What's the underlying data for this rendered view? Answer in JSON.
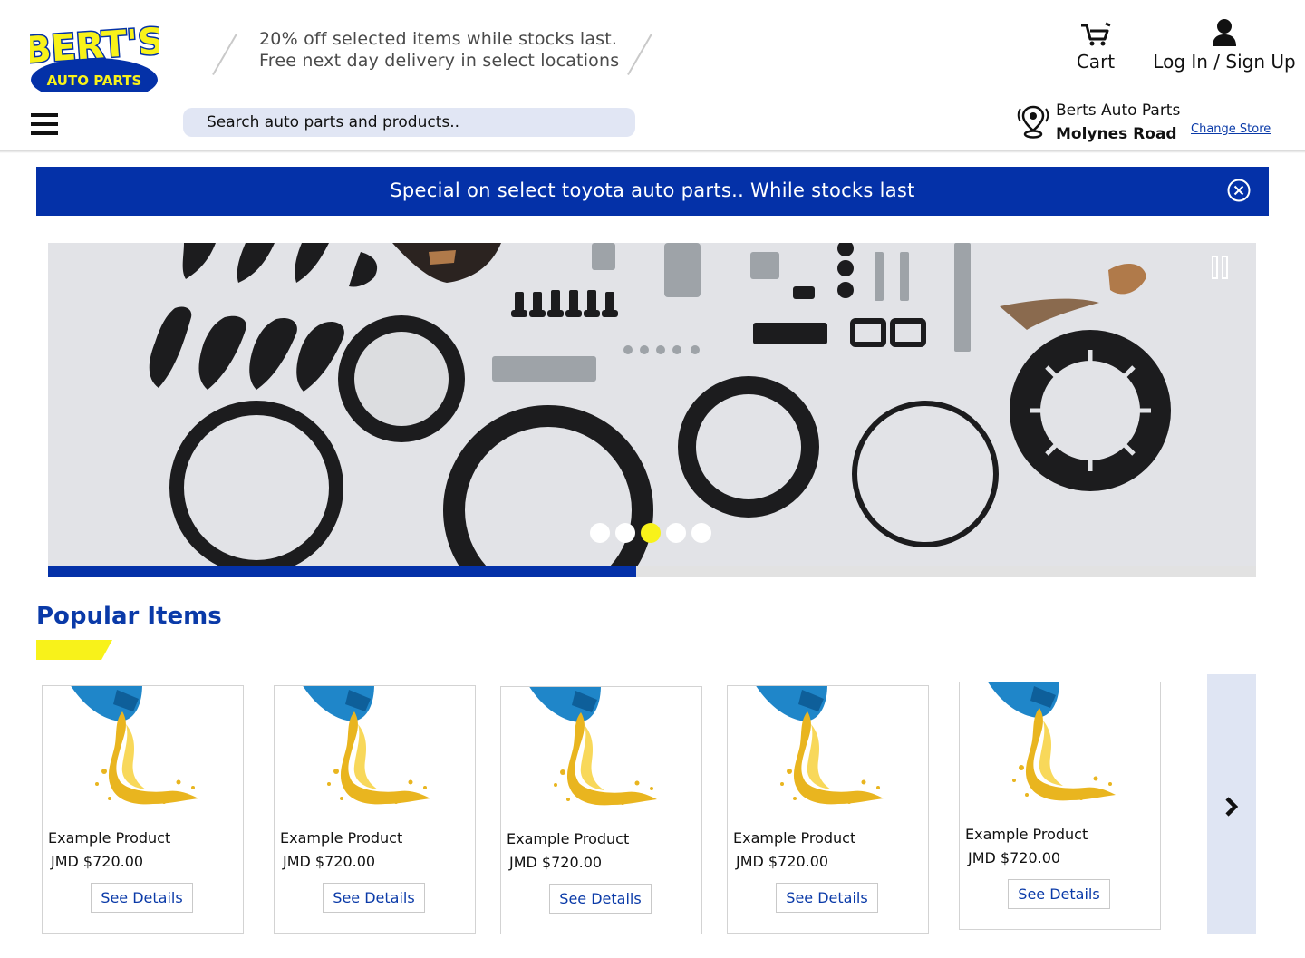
{
  "logo": {
    "top_text": "BERT'S",
    "bottom_text": "AUTO PARTS"
  },
  "header": {
    "promo_line_1": "20% off selected items while stocks last.",
    "promo_line_2": "Free next day delivery in select locations",
    "cart_label": "Cart",
    "login_label": "Log In / Sign Up"
  },
  "nav": {
    "search_placeholder": "Search auto parts and products..",
    "store_name": "Berts Auto Parts",
    "store_location": "Molynes Road",
    "change_store_label": "Change Store"
  },
  "banner": {
    "text": "Special on select toyota auto parts.. While stocks last"
  },
  "carousel": {
    "slide_count": 5,
    "active_slide_index": 2,
    "progress_fraction": 0.487
  },
  "popular": {
    "title": "Popular Items",
    "items": [
      {
        "name": "Example Product",
        "price": "JMD $720.00",
        "button": "See Details"
      },
      {
        "name": "Example Product",
        "price": "JMD $720.00",
        "button": "See Details"
      },
      {
        "name": "Example Product",
        "price": "JMD $720.00",
        "button": "See Details"
      },
      {
        "name": "Example Product",
        "price": "JMD $720.00",
        "button": "See Details"
      },
      {
        "name": "Example Product",
        "price": "JMD $720.00",
        "button": "See Details"
      }
    ]
  },
  "colors": {
    "brand_blue": "#0431a8",
    "brand_yellow": "#f8f21a",
    "search_bg": "#e1e6f4",
    "next_panel_bg": "#dfe5f3"
  },
  "icons": {
    "menu": "hamburger-icon",
    "cart": "cart-icon",
    "user": "user-icon",
    "store": "location-pin-icon",
    "close": "close-circle-icon",
    "pause": "pause-icon",
    "next": "chevron-right-icon"
  }
}
